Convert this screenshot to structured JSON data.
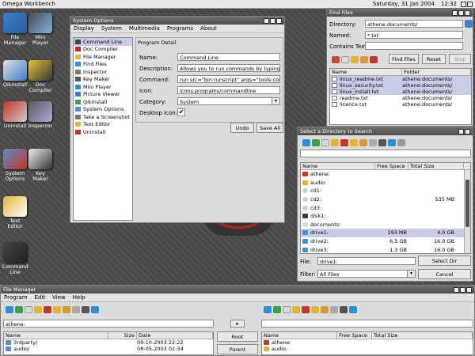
{
  "topbar": {
    "title": "Omega Workbench",
    "date": "Saturday, 31 Jan 2004",
    "time": "12:32"
  },
  "desktop_icons": [
    {
      "label": "File\nManager"
    },
    {
      "label": "Mini\nPlayer"
    },
    {
      "label": "QikInstall"
    },
    {
      "label": "Doc\nCompiler"
    },
    {
      "label": "Uninstall"
    },
    {
      "label": "Inspector"
    },
    {
      "label": "System\nOptions"
    },
    {
      "label": "Key\nMaker"
    },
    {
      "label": "Text\nEditor"
    },
    {
      "label": "Command\nLine"
    }
  ],
  "sysopt": {
    "title": "System Options",
    "menu": [
      "Display",
      "System",
      "Multimedia",
      "Programs",
      "About"
    ],
    "items": [
      "Command Line",
      "Doc Compiler",
      "File Manager",
      "Find Files",
      "Inspector",
      "Key Maker",
      "Mini Player",
      "Picture Viewer",
      "QikInstall",
      "System Options",
      "Take a Screenshot",
      "Text Editor",
      "Uninstall"
    ],
    "detail_title": "Program Detail",
    "labels": {
      "name": "Name:",
      "description": "Description:",
      "command": "Command:",
      "icon": "Icon:",
      "category": "Category:",
      "desktop_icon": "Desktop Icon:"
    },
    "values": {
      "name": "Command Line",
      "description": "Allows you to run commands by typing in text in",
      "command": "run src=\"bin:runscript\" args=\"tools:commandlin",
      "icon": "icons:programs/commandline",
      "category": "System"
    },
    "undo": "Undo",
    "save_all": "Save All"
  },
  "findfiles": {
    "title": "Find Files",
    "labels": {
      "directory": "Directory:",
      "named": "Named:",
      "contains": "Contains Text:"
    },
    "values": {
      "directory": "athene:documents/",
      "named": "*.txt",
      "contains": ""
    },
    "buttons": {
      "find": "Find Files",
      "reset": "Reset",
      "stop": "Stop"
    },
    "columns": [
      "Name",
      "Folder"
    ],
    "rows": [
      {
        "name": "linux_readme.txt",
        "folder": "athene:documents/",
        "selected": true
      },
      {
        "name": "linux_security.txt",
        "folder": "athene:documents/",
        "selected": true
      },
      {
        "name": "linux_install.txt",
        "folder": "athene:documents/",
        "selected": true
      },
      {
        "name": "readme.txt",
        "folder": "athene:documents/",
        "selected": false
      },
      {
        "name": "licence.txt",
        "folder": "athene:documents/",
        "selected": false
      }
    ]
  },
  "selectdir": {
    "title": "Select a Directory to Search",
    "columns": [
      "Name",
      "Free Space",
      "Total Size"
    ],
    "rows": [
      {
        "name": "athene:",
        "free": "",
        "total": "",
        "icon": "athene",
        "selected": false
      },
      {
        "name": "audio:",
        "free": "",
        "total": "",
        "icon": "audio",
        "selected": false
      },
      {
        "name": "cd1:",
        "free": "",
        "total": "",
        "icon": "cd",
        "selected": false
      },
      {
        "name": "cd2:",
        "free": "",
        "total": "535 MB",
        "icon": "cd",
        "selected": false
      },
      {
        "name": "cd3:",
        "free": "",
        "total": "",
        "icon": "cd",
        "selected": false
      },
      {
        "name": "disk1:",
        "free": "",
        "total": "",
        "icon": "disk",
        "selected": false
      },
      {
        "name": "documents:",
        "free": "",
        "total": "",
        "icon": "doc",
        "selected": false
      },
      {
        "name": "drive1:",
        "free": "193 MB",
        "total": "4.0 GB",
        "icon": "drive",
        "selected": true
      },
      {
        "name": "drive2:",
        "free": "6.5 GB",
        "total": "16.0 GB",
        "icon": "drive",
        "selected": false
      },
      {
        "name": "drive3:",
        "free": "1.3 GB",
        "total": "16.0 GB",
        "icon": "drive",
        "selected": false
      }
    ],
    "file_label": "File:",
    "file_value": "drive1:",
    "filter_label": "Filter:",
    "filter_value": "All Files",
    "select_btn": "Select Dir",
    "cancel_btn": "Cancel"
  },
  "filemanager": {
    "title": "File Manager",
    "menu": [
      "Program",
      "Edit",
      "View",
      "Help"
    ],
    "left_path": "athene:",
    "left_columns": [
      "Name",
      "Size",
      "Date"
    ],
    "left_rows": [
      {
        "name": "3rdparty/",
        "size": "",
        "date": "09-10-2003 22:22"
      },
      {
        "name": "audio/",
        "size": "",
        "date": "08-05-2003 02:34"
      }
    ],
    "root_btn": "Root",
    "parent_btn": "Parent",
    "arrow_btn": "▸",
    "right_path": "",
    "right_columns": [
      "Name",
      "Free Space",
      "Total Size"
    ],
    "right_rows": [
      {
        "name": "athene:"
      },
      {
        "name": "audio:"
      }
    ]
  }
}
